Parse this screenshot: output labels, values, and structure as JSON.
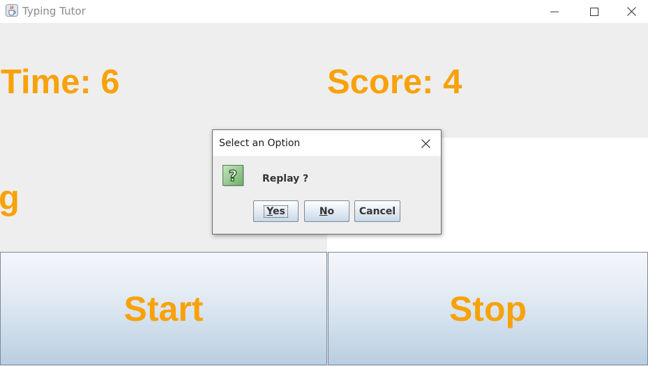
{
  "window": {
    "title": "Typing Tutor",
    "icons": {
      "app": "java-cup-icon",
      "minimize": "minimize-icon",
      "maximize": "maximize-icon",
      "close": "close-icon"
    }
  },
  "game": {
    "time_label": "Time: 6",
    "score_label": "Score: 4",
    "current_word": "g",
    "start_label": "Start",
    "stop_label": "Stop",
    "accent_color": "#f8a20a"
  },
  "dialog": {
    "title": "Select an Option",
    "message": "Replay ?",
    "icon": "question-icon",
    "buttons": {
      "yes_mnemonic": "Y",
      "yes_rest": "es",
      "no_mnemonic": "N",
      "no_rest": "o",
      "cancel": "Cancel"
    }
  }
}
